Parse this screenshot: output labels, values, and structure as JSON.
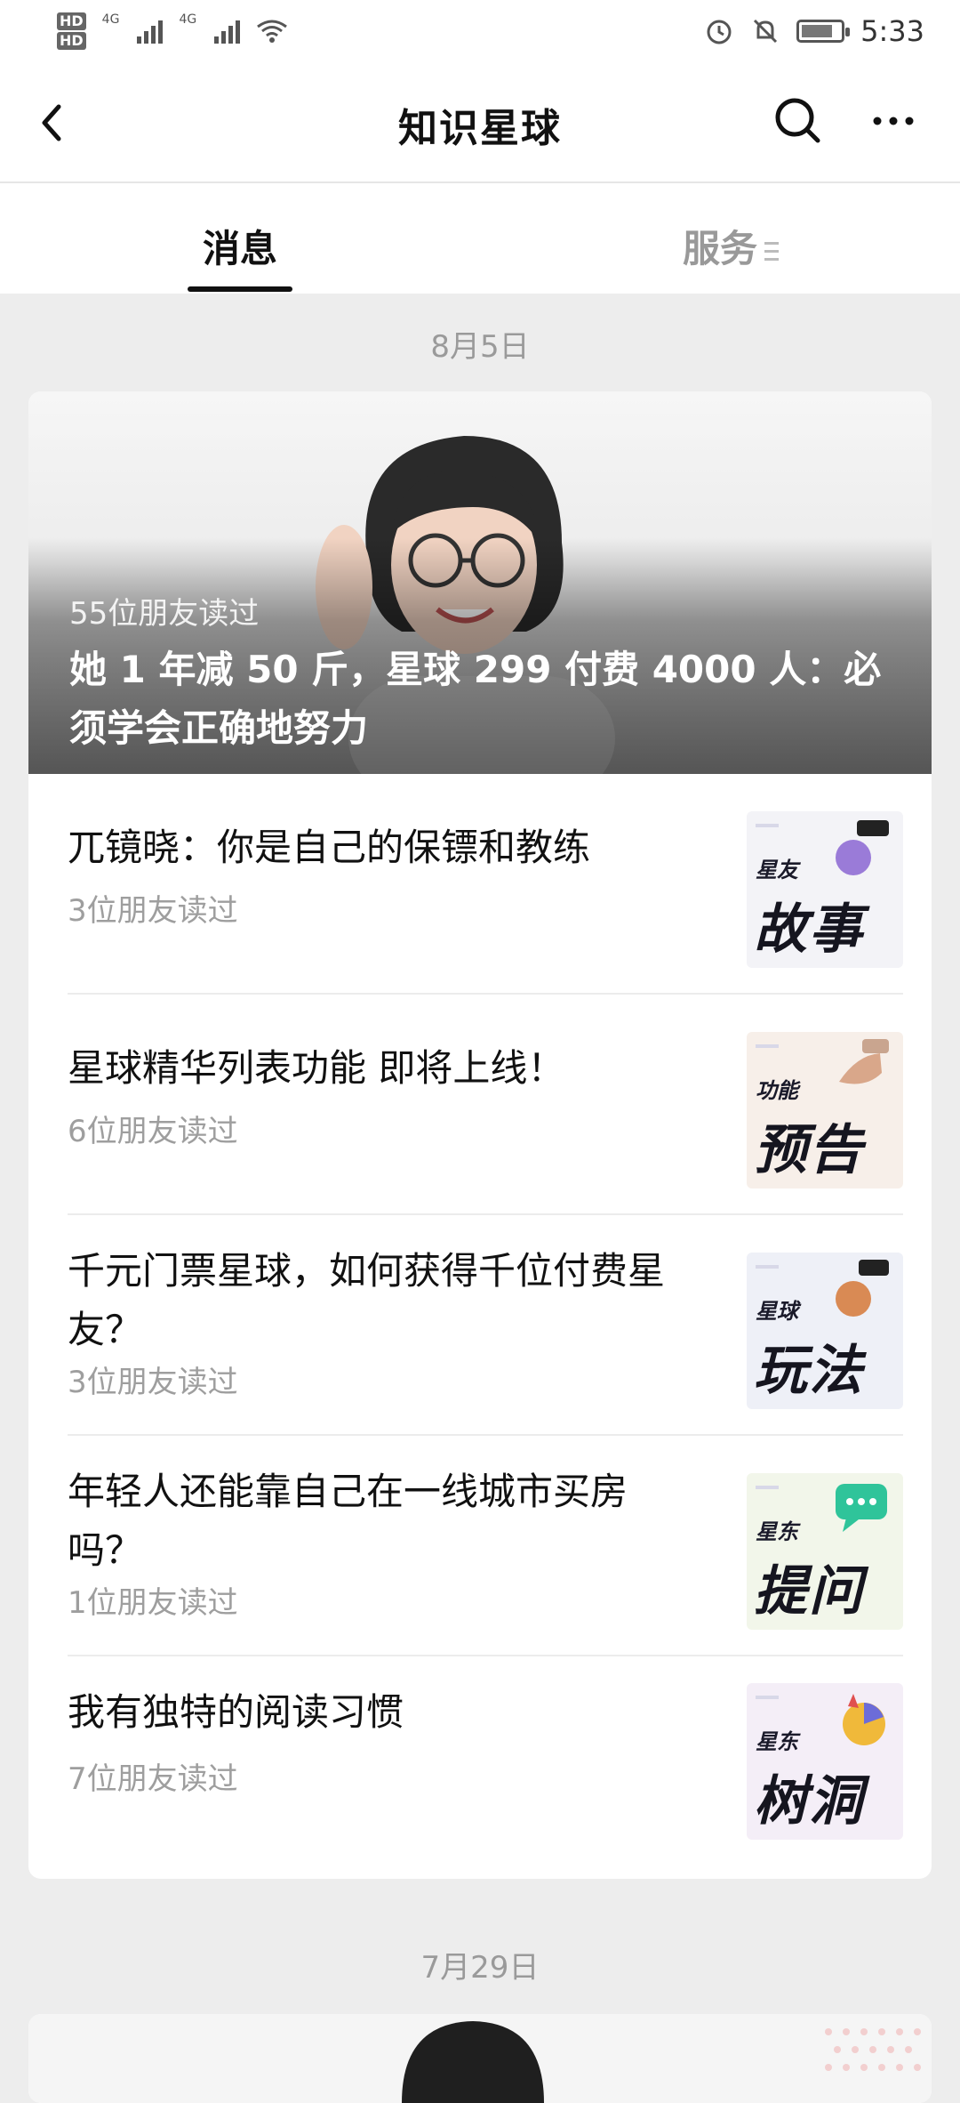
{
  "status_bar": {
    "time": "5:33",
    "network": "4G",
    "icons": [
      "hd-icon",
      "signal-icon",
      "wifi-icon",
      "alarm-icon",
      "mute-bell-icon",
      "battery-icon"
    ]
  },
  "header": {
    "title": "知识星球",
    "back_icon": "chevron-left-icon",
    "search_icon": "search-icon",
    "more_icon": "more-dots-icon"
  },
  "tabs": {
    "messages": "消息",
    "services": "服务"
  },
  "groups": [
    {
      "date": "8月5日",
      "hero": {
        "reads": "55位朋友读过",
        "title": "她 1 年减 50 斤，星球 299 付费 4000 人：必须学会正确地努力"
      },
      "items": [
        {
          "title": "兀镜晓：你是自己的保镖和教练",
          "reads": "3位朋友读过",
          "thumb_top": "星友",
          "thumb_main": "故事",
          "thumb_color": "#9a7bd8"
        },
        {
          "title": "星球精华列表功能 即将上线！",
          "reads": "6位朋友读过",
          "thumb_top": "功能",
          "thumb_main": "预告",
          "thumb_color": "#d9a78a"
        },
        {
          "title": "千元门票星球，如何获得千位付费星友？",
          "reads": "3位朋友读过",
          "thumb_top": "星球",
          "thumb_main": "玩法",
          "thumb_color": "#d98a54"
        },
        {
          "title": "年轻人还能靠自己在一线城市买房吗？",
          "reads": "1位朋友读过",
          "thumb_top": "星东",
          "thumb_main": "提问",
          "thumb_color": "#2fc49a"
        },
        {
          "title": "我有独特的阅读习惯",
          "reads": "7位朋友读过",
          "thumb_top": "星东",
          "thumb_main": "树洞",
          "thumb_color": "#f0b93a"
        }
      ]
    },
    {
      "date": "7月29日"
    }
  ]
}
